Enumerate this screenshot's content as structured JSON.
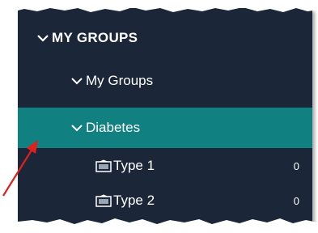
{
  "tree": {
    "section_header": "MY GROUPS",
    "subfolder": "My Groups",
    "selected_folder": "Diabetes",
    "groups": [
      {
        "label": "Type 1",
        "count": "0",
        "icon": "group-icon"
      },
      {
        "label": "Type 2",
        "count": "0",
        "icon": "group-icon"
      }
    ]
  },
  "colors": {
    "panel_bg": "#1b2638",
    "selected_bg": "#108080",
    "text": "#ffffff",
    "arrow": "#e0201c"
  }
}
